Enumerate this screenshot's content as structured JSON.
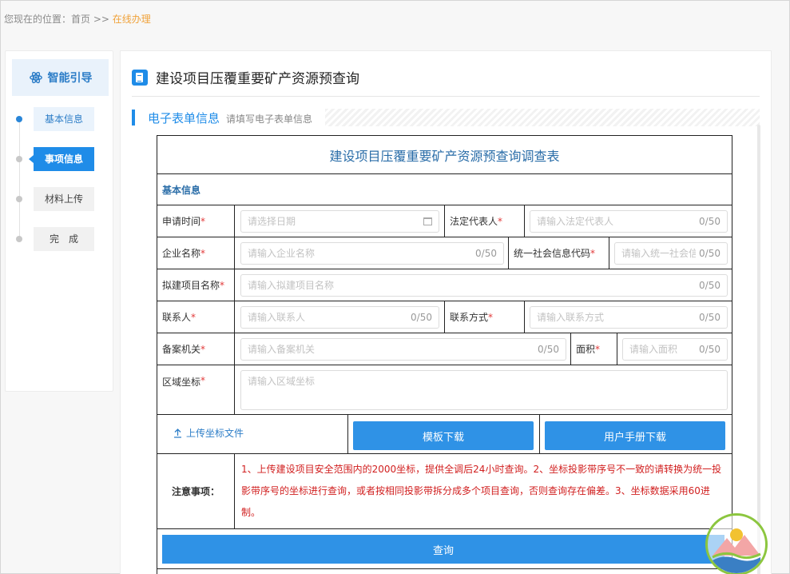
{
  "breadcrumb": {
    "prefix": "您现在的位置：首页 >> ",
    "current": "在线办理"
  },
  "sidebar": {
    "guide_label": "智能引导",
    "steps": [
      {
        "label": "基本信息",
        "state": "done"
      },
      {
        "label": "事项信息",
        "state": "active"
      },
      {
        "label": "材料上传",
        "state": "todo"
      },
      {
        "label": "完　成",
        "state": "todo"
      }
    ]
  },
  "page": {
    "title": "建设项目压覆重要矿产资源预查询",
    "section_name": "电子表单信息",
    "section_hint": "请填写电子表单信息"
  },
  "form": {
    "title": "建设项目压覆重要矿产资源预查询调查表",
    "basic_header": "基本信息",
    "required_mark": "*",
    "fields": {
      "apply_time": {
        "label": "申请时间",
        "placeholder": "请选择日期"
      },
      "legal_rep": {
        "label": "法定代表人",
        "placeholder": "请输入法定代表人",
        "count": "0/50"
      },
      "company": {
        "label": "企业名称",
        "placeholder": "请输入企业名称",
        "count": "0/50"
      },
      "credit_code": {
        "label": "统一社会信息代码",
        "placeholder": "请输入统一社会信",
        "count": "0/50"
      },
      "project": {
        "label": "拟建项目名称",
        "placeholder": "请输入拟建项目名称",
        "count": "0/50"
      },
      "contact": {
        "label": "联系人",
        "placeholder": "请输入联系人",
        "count": "0/50"
      },
      "phone": {
        "label": "联系方式",
        "placeholder": "请输入联系方式",
        "count": "0/50"
      },
      "agency": {
        "label": "备案机关",
        "placeholder": "请输入备案机关",
        "count": "0/50"
      },
      "area": {
        "label": "面积",
        "placeholder": "请输入面积",
        "count": "0/50"
      },
      "coords": {
        "label": "区域坐标",
        "placeholder": "请输入区域坐标"
      }
    },
    "upload_label": "上传坐标文件",
    "template_button": "模板下载",
    "manual_button": "用户手册下载",
    "notice_label": "注意事项：",
    "notice_text": "1、上传建设项目安全范围内的2000坐标，提供全调后24小时查询。2、坐标投影带序号不一致的请转换为统一投影带序号的坐标进行查询，或者按相同投影带拆分成多个项目查询，否则查询存在偏差。3、坐标数据采用60进制。",
    "query_button": "查询"
  },
  "colors": {
    "primary": "#1f8ce8",
    "required": "#e23b3b",
    "notice": "#d11f1f",
    "breadcrumb_current": "#f0a23a"
  }
}
